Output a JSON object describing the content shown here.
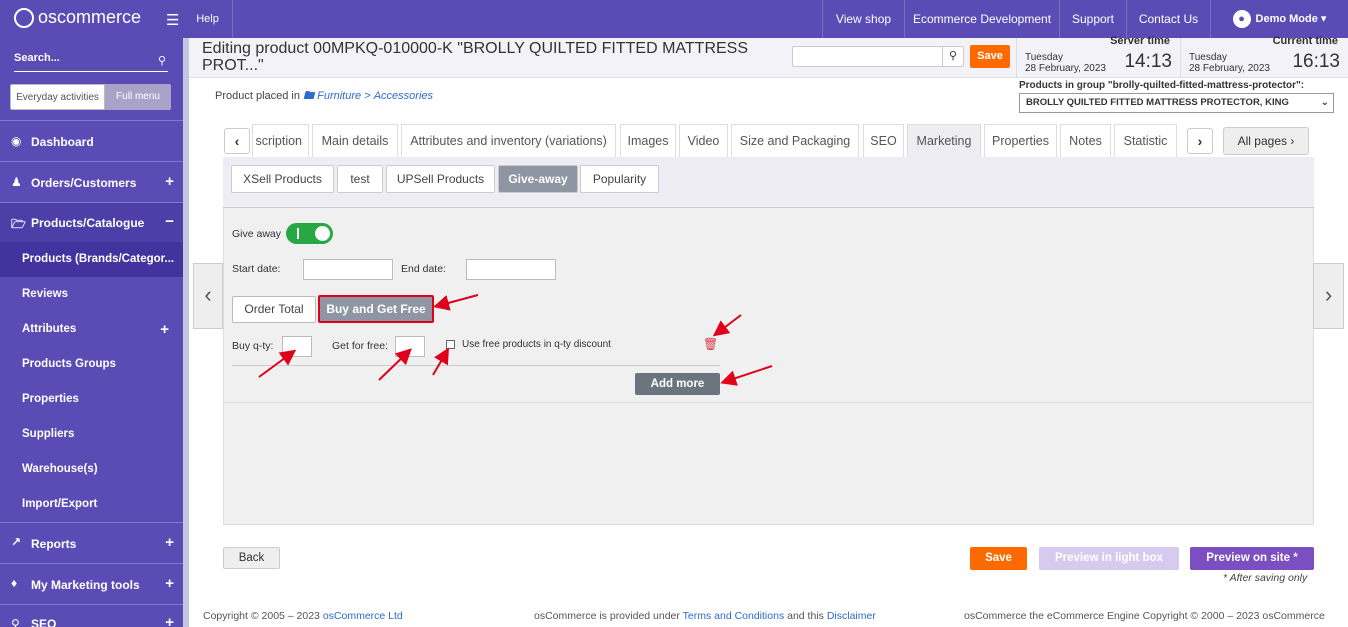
{
  "sidebar": {
    "logo": "oscommerce",
    "search_label": "Search...",
    "toggle_everyday": "Everyday activities",
    "toggle_full": "Full menu",
    "nav": [
      {
        "label": "Dashboard",
        "sign": ""
      },
      {
        "label": "Orders/Customers",
        "sign": "+"
      },
      {
        "label": "Products/Catalogue",
        "sign": "−"
      }
    ],
    "sub": [
      {
        "label": "Products (Brands/Categor...",
        "sign": ""
      },
      {
        "label": "Reviews",
        "sign": ""
      },
      {
        "label": "Attributes",
        "sign": "+"
      },
      {
        "label": "Products Groups",
        "sign": ""
      },
      {
        "label": "Properties",
        "sign": ""
      },
      {
        "label": "Suppliers",
        "sign": ""
      },
      {
        "label": "Warehouse(s)",
        "sign": ""
      },
      {
        "label": "Import/Export",
        "sign": ""
      }
    ],
    "nav2": [
      {
        "label": "Reports",
        "sign": "+"
      },
      {
        "label": "My Marketing tools",
        "sign": "+"
      },
      {
        "label": "SEO",
        "sign": "+"
      }
    ]
  },
  "topbar": {
    "help": "Help",
    "links": [
      "View shop",
      "Ecommerce Development",
      "Support",
      "Contact Us"
    ],
    "user": "Demo Mode"
  },
  "header": {
    "title": "Editing product 00MPKQ-010000-K \"BROLLY QUILTED FITTED MATTRESS PROT...\"",
    "search_value": "",
    "save": "Save",
    "server_label": "Server time",
    "server_day": "Tuesday",
    "server_date": "28 February, 2023",
    "server_time": "14:13",
    "current_label": "Current time",
    "current_day": "Tuesday",
    "current_date": "28 February, 2023",
    "current_time": "16:13"
  },
  "placement": {
    "prefix": "Product placed in",
    "category": "Furniture",
    "sep": ">",
    "sub": "Accessories"
  },
  "group": {
    "label": "Products in group \"brolly-quilted-fitted-mattress-protector\":",
    "selected": "BROLLY QUILTED FITTED MATTRESS PROTECTOR, KING"
  },
  "tabs": [
    "scription",
    "Main details",
    "Attributes and inventory (variations)",
    "Images",
    "Video",
    "Size and Packaging",
    "SEO",
    "Marketing",
    "Properties",
    "Notes",
    "Statistic"
  ],
  "all_pages": "All pages",
  "subtabs": [
    "XSell Products",
    "test",
    "UPSell Products",
    "Give-away",
    "Popularity"
  ],
  "giveaway": {
    "give_away_label": "Give away",
    "give_away_on": true,
    "start_label": "Start date:",
    "start_value": "",
    "end_label": "End date:",
    "end_value": "",
    "mode_order_total": "Order Total",
    "mode_buy_get": "Buy and Get Free",
    "buy_qty_label": "Buy q-ty:",
    "get_free_label": "Get for free:",
    "use_free_label": "Use free products in q-ty discount",
    "add_more": "Add more"
  },
  "actions": {
    "back": "Back",
    "save": "Save",
    "preview_lightbox": "Preview in light box",
    "preview_site": "Preview on site *",
    "after_saving": "* After saving only"
  },
  "footer": {
    "copyright_prefix": "Copyright © 2005 – 2023",
    "copyright_link": "osCommerce Ltd",
    "provided_prefix": "osCommerce is provided under",
    "terms": "Terms and Conditions",
    "and_this": "and this",
    "disclaimer": "Disclaimer",
    "engine": "osCommerce the eCommerce Engine Copyright © 2000 – 2023 osCommerce"
  },
  "colors": {
    "sidebar": "#5b4bb5",
    "sidebar_active": "#42339e",
    "accent_orange": "#ff6a00",
    "toggle_green": "#28a745",
    "annotation_red": "#e0001b",
    "preview_site": "#7b4fc2"
  }
}
